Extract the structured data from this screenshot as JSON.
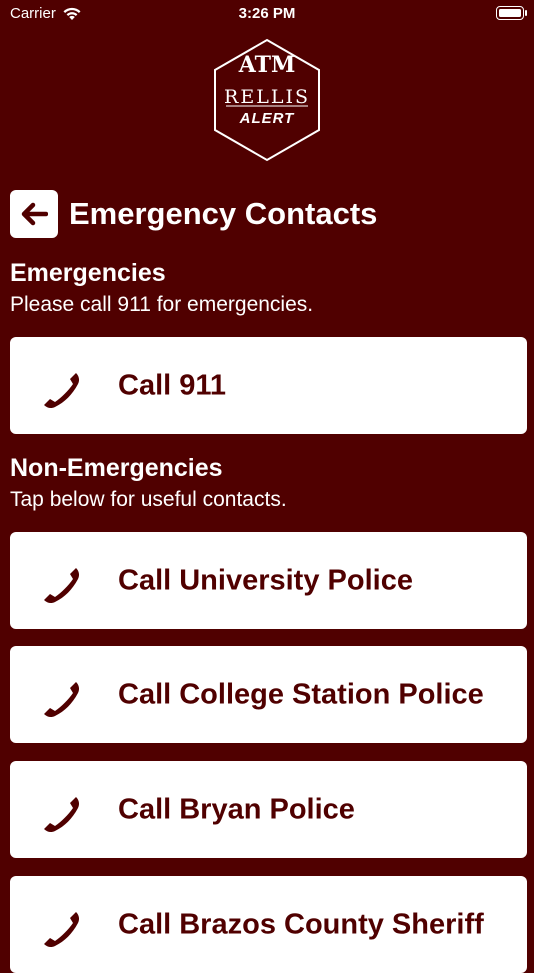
{
  "status_bar": {
    "carrier": "Carrier",
    "time": "3:26 PM"
  },
  "logo": {
    "top": "ATM",
    "middle": "RELLIS",
    "bottom": "ALERT"
  },
  "header": {
    "back_icon": "arrow-left-icon",
    "title": "Emergency Contacts"
  },
  "emergencies": {
    "title": "Emergencies",
    "subtitle": "Please call 911 for emergencies.",
    "items": [
      {
        "label": "Call 911",
        "icon": "phone-icon"
      }
    ]
  },
  "non_emergencies": {
    "title": "Non-Emergencies",
    "subtitle": "Tap below for useful contacts.",
    "items": [
      {
        "label": "Call University Police",
        "icon": "phone-icon"
      },
      {
        "label": "Call College Station Police",
        "icon": "phone-icon"
      },
      {
        "label": "Call Bryan Police",
        "icon": "phone-icon"
      },
      {
        "label": "Call Brazos County Sheriff",
        "icon": "phone-icon"
      }
    ]
  },
  "colors": {
    "background": "#500000",
    "card": "#ffffff",
    "accent_text": "#500000"
  }
}
